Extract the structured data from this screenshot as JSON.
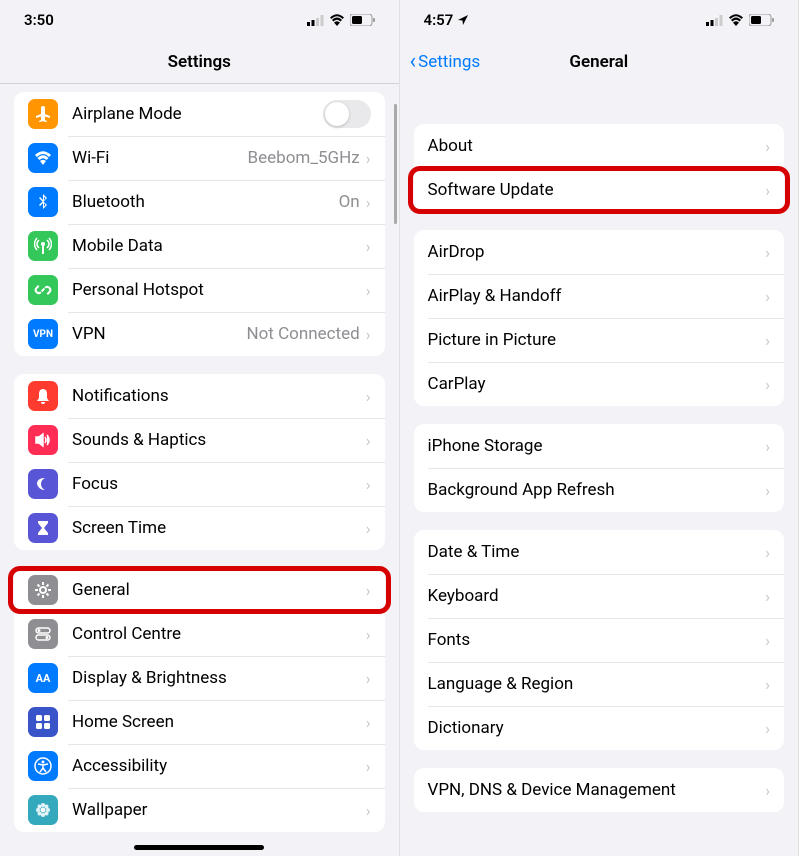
{
  "left": {
    "status": {
      "time": "3:50"
    },
    "nav": {
      "title": "Settings"
    },
    "sections": [
      [
        {
          "key": "airplane",
          "label": "Airplane Mode",
          "icon": "airplane-icon",
          "toggle": true
        },
        {
          "key": "wifi",
          "label": "Wi-Fi",
          "icon": "wifi-icon",
          "value": "Beebom_5GHz"
        },
        {
          "key": "bluetooth",
          "label": "Bluetooth",
          "icon": "bluetooth-icon",
          "value": "On"
        },
        {
          "key": "mobiledata",
          "label": "Mobile Data",
          "icon": "antenna-icon"
        },
        {
          "key": "hotspot",
          "label": "Personal Hotspot",
          "icon": "link-icon"
        },
        {
          "key": "vpn",
          "label": "VPN",
          "icon": "vpn-icon",
          "value": "Not Connected"
        }
      ],
      [
        {
          "key": "notifications",
          "label": "Notifications",
          "icon": "bell-icon"
        },
        {
          "key": "sounds",
          "label": "Sounds & Haptics",
          "icon": "speaker-icon"
        },
        {
          "key": "focus",
          "label": "Focus",
          "icon": "moon-icon"
        },
        {
          "key": "screentime",
          "label": "Screen Time",
          "icon": "hourglass-icon"
        }
      ],
      [
        {
          "key": "general",
          "label": "General",
          "icon": "gear-icon",
          "highlight": true
        },
        {
          "key": "controlcentre",
          "label": "Control Centre",
          "icon": "switches-icon"
        },
        {
          "key": "display",
          "label": "Display & Brightness",
          "icon": "text-size-icon"
        },
        {
          "key": "homescreen",
          "label": "Home Screen",
          "icon": "grid-icon"
        },
        {
          "key": "accessibility",
          "label": "Accessibility",
          "icon": "accessibility-icon"
        },
        {
          "key": "wallpaper",
          "label": "Wallpaper",
          "icon": "flower-icon"
        }
      ]
    ]
  },
  "right": {
    "status": {
      "time": "4:57",
      "location": true
    },
    "nav": {
      "back": "Settings",
      "title": "General"
    },
    "sections": [
      [
        {
          "key": "about",
          "label": "About"
        },
        {
          "key": "softwareupdate",
          "label": "Software Update",
          "highlight": true
        }
      ],
      [
        {
          "key": "airdrop",
          "label": "AirDrop"
        },
        {
          "key": "airplay",
          "label": "AirPlay & Handoff"
        },
        {
          "key": "pip",
          "label": "Picture in Picture"
        },
        {
          "key": "carplay",
          "label": "CarPlay"
        }
      ],
      [
        {
          "key": "storage",
          "label": "iPhone Storage"
        },
        {
          "key": "bgrefresh",
          "label": "Background App Refresh"
        }
      ],
      [
        {
          "key": "datetime",
          "label": "Date & Time"
        },
        {
          "key": "keyboard",
          "label": "Keyboard"
        },
        {
          "key": "fonts",
          "label": "Fonts"
        },
        {
          "key": "language",
          "label": "Language & Region"
        },
        {
          "key": "dictionary",
          "label": "Dictionary"
        }
      ],
      [
        {
          "key": "vpndns",
          "label": "VPN, DNS & Device Management"
        }
      ]
    ]
  }
}
